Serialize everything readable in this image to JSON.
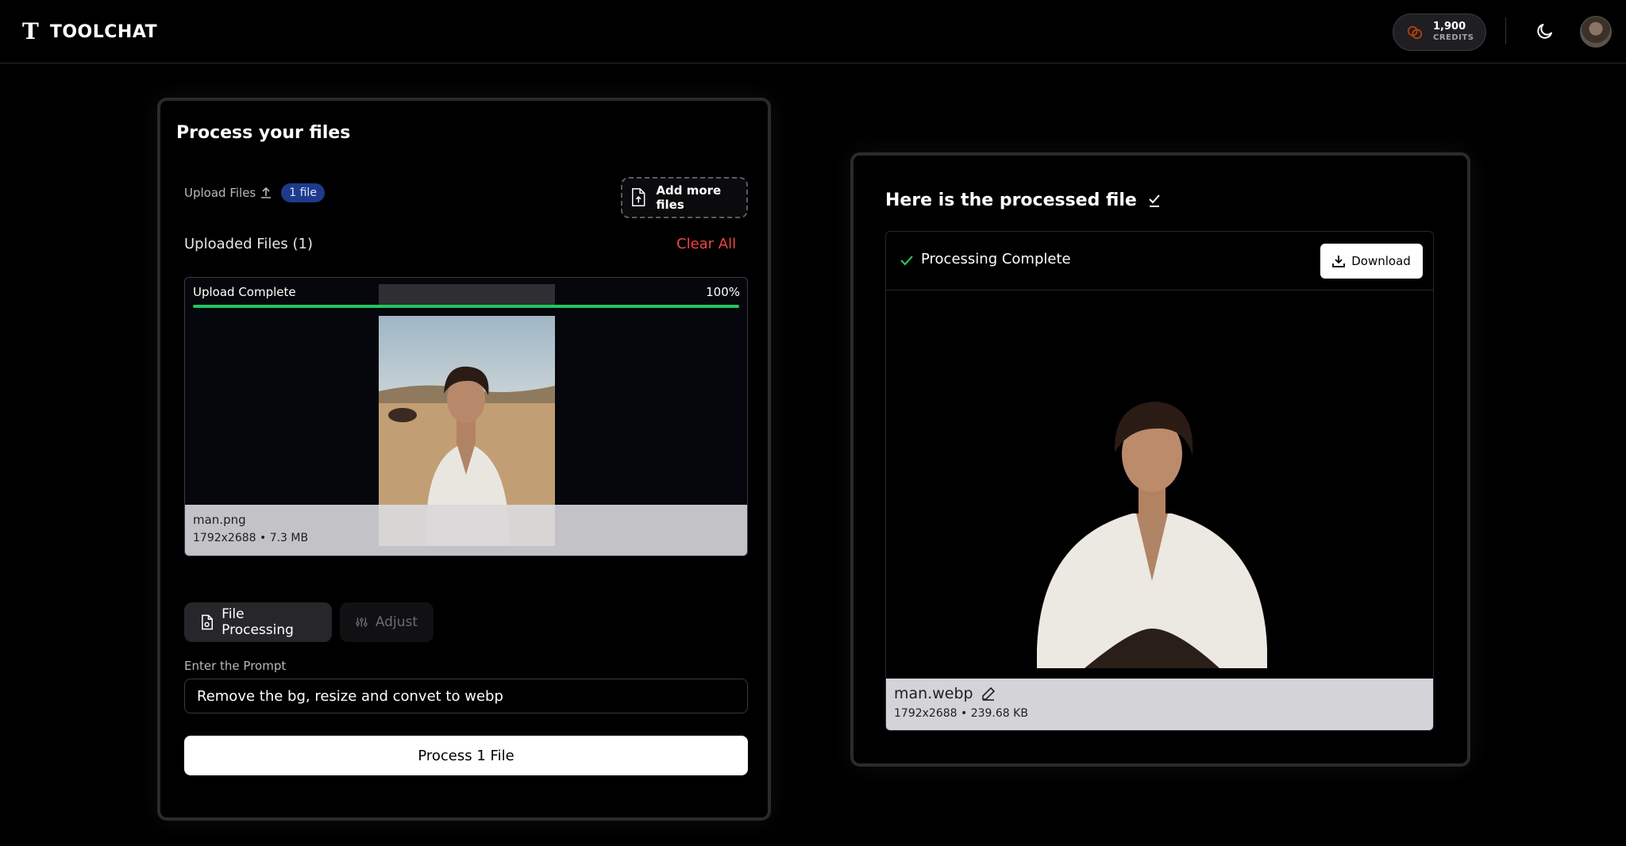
{
  "header": {
    "logo_mark": "T",
    "app_name": "TOOLCHAT",
    "credits_value": "1,900",
    "credits_label": "CREDITS"
  },
  "left_card": {
    "title": "Process your files",
    "upload_label": "Upload Files",
    "file_badge": "1 file",
    "add_more_label": "Add more files",
    "uploaded_title": "Uploaded Files (1)",
    "clear_all_label": "Clear All",
    "preview": {
      "status": "Upload Complete",
      "percent_label": "100%",
      "progress": 1.0,
      "file_name": "man.png",
      "file_meta": "1792x2688 • 7.3 MB"
    },
    "tabs": [
      {
        "label": "File Processing",
        "active": true
      },
      {
        "label": "Adjust",
        "active": false
      }
    ],
    "prompt_label": "Enter the Prompt",
    "prompt_value": "Remove the bg, resize and convet to webp",
    "process_button": "Process 1 File"
  },
  "right_card": {
    "title": "Here is the processed file",
    "status": "Processing Complete",
    "download_label": "Download",
    "file_name": "man.webp",
    "file_meta": "1792x2688 • 239.68 KB"
  },
  "colors": {
    "accent_green": "#22c55e",
    "danger_red": "#ef4444",
    "badge_blue": "#1e3a8a"
  }
}
